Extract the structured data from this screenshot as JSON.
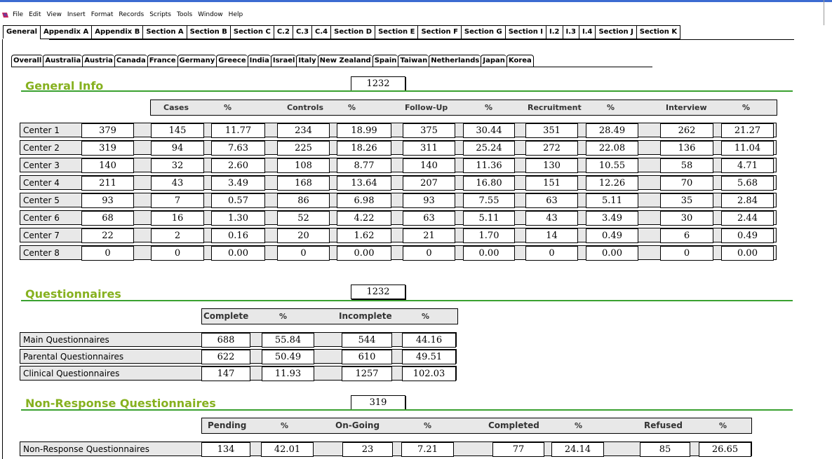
{
  "menu": [
    "File",
    "Edit",
    "View",
    "Insert",
    "Format",
    "Records",
    "Scripts",
    "Tools",
    "Window",
    "Help"
  ],
  "main_tabs": [
    "General",
    "Appendix A",
    "Appendix B",
    "Section A",
    "Section B",
    "Section C",
    "C.2",
    "C.3",
    "C.4",
    "Section D",
    "Section E",
    "Section F",
    "Section G",
    "Section I",
    "I.2",
    "I.3",
    "I.4",
    "Section J",
    "Section K"
  ],
  "country_tabs": [
    "Overall",
    "Australia",
    "Austria",
    "Canada",
    "France",
    "Germany",
    "Greece",
    "India",
    "Israel",
    "Italy",
    "New Zealand",
    "Spain",
    "Taiwan",
    "Netherlands",
    "Japan",
    "Korea"
  ],
  "general": {
    "title": "General Info",
    "total": "1232",
    "headers": [
      "Cases",
      "%",
      "Controls",
      "%",
      "Follow-Up",
      "%",
      "Recruitment",
      "%",
      "Interview",
      "%"
    ],
    "rows": [
      {
        "label": "Center 1",
        "total": "379",
        "values": [
          "145",
          "11.77",
          "234",
          "18.99",
          "375",
          "30.44",
          "351",
          "28.49",
          "262",
          "21.27"
        ]
      },
      {
        "label": "Center 2",
        "total": "319",
        "values": [
          "94",
          "7.63",
          "225",
          "18.26",
          "311",
          "25.24",
          "272",
          "22.08",
          "136",
          "11.04"
        ]
      },
      {
        "label": "Center 3",
        "total": "140",
        "values": [
          "32",
          "2.60",
          "108",
          "8.77",
          "140",
          "11.36",
          "130",
          "10.55",
          "58",
          "4.71"
        ]
      },
      {
        "label": "Center 4",
        "total": "211",
        "values": [
          "43",
          "3.49",
          "168",
          "13.64",
          "207",
          "16.80",
          "151",
          "12.26",
          "70",
          "5.68"
        ]
      },
      {
        "label": "Center 5",
        "total": "93",
        "values": [
          "7",
          "0.57",
          "86",
          "6.98",
          "93",
          "7.55",
          "63",
          "5.11",
          "35",
          "2.84"
        ]
      },
      {
        "label": "Center 6",
        "total": "68",
        "values": [
          "16",
          "1.30",
          "52",
          "4.22",
          "63",
          "5.11",
          "43",
          "3.49",
          "30",
          "2.44"
        ]
      },
      {
        "label": "Center 7",
        "total": "22",
        "values": [
          "2",
          "0.16",
          "20",
          "1.62",
          "21",
          "1.70",
          "14",
          "0.49",
          "6",
          "0.49"
        ]
      },
      {
        "label": "Center 8",
        "total": "0",
        "values": [
          "0",
          "0.00",
          "0",
          "0.00",
          "0",
          "0.00",
          "0",
          "0.00",
          "0",
          "0.00"
        ]
      }
    ]
  },
  "questionnaires": {
    "title": "Questionnaires",
    "total": "1232",
    "headers": [
      "Complete",
      "%",
      "Incomplete",
      "%"
    ],
    "rows": [
      {
        "label": "Main Questionnaires",
        "values": [
          "688",
          "55.84",
          "544",
          "44.16"
        ]
      },
      {
        "label": "Parental Questionnaires",
        "values": [
          "622",
          "50.49",
          "610",
          "49.51"
        ]
      },
      {
        "label": "Clinical Questionnaires",
        "values": [
          "147",
          "11.93",
          "1257",
          "102.03"
        ]
      }
    ]
  },
  "nonresponse": {
    "title": "Non-Response Questionnaires",
    "total": "319",
    "headers": [
      "Pending",
      "%",
      "On-Going",
      "%",
      "Completed",
      "%",
      "Refused",
      "%"
    ],
    "rows": [
      {
        "label": "Non-Response Questionnaires",
        "values": [
          "134",
          "42.01",
          "23",
          "7.21",
          "77",
          "24.14",
          "85",
          "26.65"
        ]
      }
    ]
  }
}
